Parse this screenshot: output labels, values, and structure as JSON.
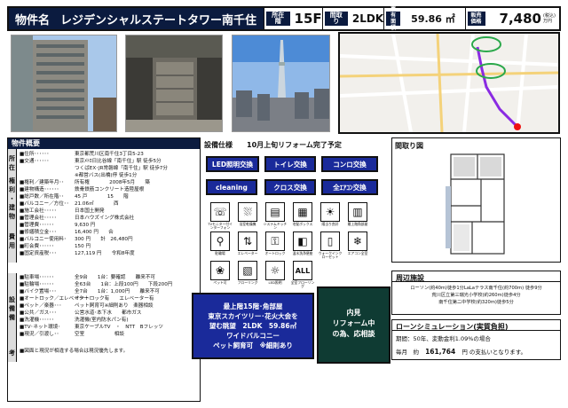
{
  "header": {
    "label": "物件名",
    "name": "レジデンシャルステートタワー南千住",
    "floor_label": "所在階",
    "floor": "15F",
    "layout_label": "間取り",
    "layout": "2LDK",
    "area_label": "専有面積",
    "area": "59.86 ㎡",
    "price_label": "販売価格",
    "price": "7,480",
    "price_unit": "(税込)万円"
  },
  "overview": {
    "title": "物件概要",
    "side": [
      "所",
      "在",
      "権",
      "利",
      "・",
      "建",
      "物",
      "費",
      "用",
      "設",
      "備",
      "備",
      "考"
    ],
    "rows": [
      [
        "■住所･･････",
        "東京都荒川区南千住3丁目5-23"
      ],
      [
        "■交通･･････",
        "東京ﾒﾄﾛ日比谷線「南千住」駅 徒歩5分"
      ],
      [
        "",
        "つくばEX･JR常磐線「南千住」駅 徒歩7分"
      ],
      [
        "",
        "※都営バス(出橋)停 徒歩1分"
      ],
      [
        "■権利／建築年月･･",
        "所有権　　　　2008年5月　　築"
      ],
      [
        "■建物構造･･････",
        "鉄骨鉄筋コンクリート造陸屋根"
      ],
      [
        "■総戸数／所在階･･",
        "45 戸　　　　15　　階"
      ],
      [
        "■バルコニー／方位･･",
        "21.06㎡　　　　西"
      ],
      [
        "■施工会社･････",
        "日本国土開発"
      ],
      [
        "■管理会社･････",
        "日本ハウズイング株式会社"
      ],
      [
        "■管理費･･････",
        "9,630 円"
      ],
      [
        "■修繕積立金･･･",
        "16,400 円　　合"
      ],
      [
        "■バルコニー使用料･",
        "300 円　　計　26,480円"
      ],
      [
        "■町会費･･････",
        "150 円"
      ],
      [
        "■固定資産税･･･",
        "127,119 円　　令和8年度"
      ],
      [
        "■駐車場･･････",
        "全9台　　1台：要確認　　離来不可"
      ],
      [
        "■駐輪場･･････",
        "全63台　　1台：上段100円　　下段200円"
      ],
      [
        "■バイク置場･･･",
        "全7台　　1台：1,000円　　離来不可"
      ],
      [
        "■オートロック／エレベーター",
        "オートロック有　　エレベーター有"
      ],
      [
        "■ペット／楽器･･･",
        "ペット飼育可※細則あり　楽器相談"
      ],
      [
        "■公共／ガス･･･",
        "公営水道･本下水　　都市ガス"
      ],
      [
        "■洗濯機･･････",
        "洗濯機(室内防水パン有)"
      ],
      [
        "■TV･ネット環境･",
        "東京ケーブルTV　・　NTT　Bフレッツ"
      ],
      [
        "■現況／引渡し･･",
        "空室　　　　　　相談"
      ],
      [
        "",
        ""
      ],
      [
        "■図面と現況が相違する場合は現況優先します。",
        ""
      ]
    ]
  },
  "equipment": {
    "title": "設備仕様　　10月上旬リフォーム完了予定",
    "buttons": [
      "LED照明交換",
      "トイレ交換",
      "コンロ交換",
      "cleaning",
      "クロス交換",
      "全ｴｱｺﾝ交換"
    ],
    "icons": [
      {
        "name": "intercom-icon",
        "glyph": "☏",
        "cap": "TVモニター付インターフォン"
      },
      {
        "name": "shower-icon",
        "glyph": "⛆",
        "cap": "浴室乾燥機"
      },
      {
        "name": "kitchen-icon",
        "glyph": "▤",
        "cap": "システムキッチン"
      },
      {
        "name": "storage-icon",
        "glyph": "▦",
        "cap": "宅配ボックス"
      },
      {
        "name": "sun-icon",
        "glyph": "☀",
        "cap": "陽当り良好"
      },
      {
        "name": "building-icon",
        "glyph": "▥",
        "cap": "最上階角部屋"
      },
      {
        "name": "bicycle-icon",
        "glyph": "⚲",
        "cap": "駐輪場"
      },
      {
        "name": "elevator-icon",
        "glyph": "⇅",
        "cap": "エレベーター"
      },
      {
        "name": "lock-icon",
        "glyph": "⚿",
        "cap": "オートロック"
      },
      {
        "name": "toilet-icon",
        "glyph": "◧",
        "cap": "温水洗浄便座"
      },
      {
        "name": "door-icon",
        "glyph": "▯",
        "cap": "ウォークインクローゼット"
      },
      {
        "name": "aircon-icon",
        "glyph": "❄",
        "cap": "エアコン全室"
      },
      {
        "name": "pet-icon",
        "glyph": "❀",
        "cap": "ペット可"
      },
      {
        "name": "floor-icon",
        "glyph": "▧",
        "cap": "フローリング"
      },
      {
        "name": "lighting-icon",
        "glyph": "☼",
        "cap": "LED照明"
      },
      {
        "name": "all-floor-icon",
        "glyph": "ALL",
        "cap": "全室フローリング"
      }
    ],
    "feature": "最上階15階･角部屋\n東京スカイツリー･花火大会を\n望む眺望　2LDK　59.86㎡\nワイドバルコニー\nペット飼育可　※細則あり",
    "viewing": "内見\nリフォーム中\nの為、応相談"
  },
  "floorplan": {
    "title": "間取り図"
  },
  "nearby": {
    "title": "周辺施設",
    "lines": [
      "ローソン(約40m)徒歩1分LaLaテラス南千住(約700m) 徒歩9分",
      "荒川区立第三瑞光小学校(約260m)徒歩4分",
      "南千住第二中学校(約320m)徒歩5分"
    ]
  },
  "loan": {
    "title": "ローンシミュレーション(実質負担)",
    "line1": "期間：50年、変動金利1.09%の場合",
    "monthly_label": "毎月　約",
    "monthly": "161,764",
    "monthly_tail": "円 の支払いとなります。"
  }
}
